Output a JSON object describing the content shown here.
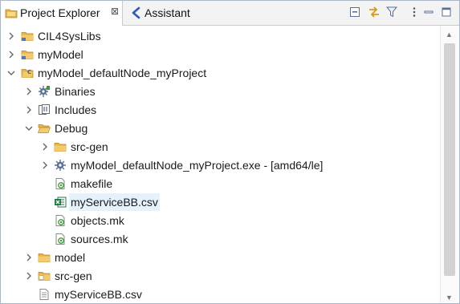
{
  "tabs": {
    "project_explorer": {
      "label": "Project Explorer",
      "close_glyph": "⊠"
    },
    "assistant": {
      "label": "Assistant"
    }
  },
  "toolbar": {
    "icons": [
      "collapse-all-icon",
      "link-with-editor-icon",
      "filter-icon",
      "view-menu-icon",
      "minimize-icon",
      "maximize-icon"
    ]
  },
  "tree": [
    {
      "label": "CIL4SysLibs",
      "icon": "project-folder-icon",
      "expanded": false,
      "depth": 0
    },
    {
      "label": "myModel",
      "icon": "project-folder-icon",
      "expanded": false,
      "depth": 0
    },
    {
      "label": "myModel_defaultNode_myProject",
      "icon": "cpp-project-folder-icon",
      "expanded": true,
      "depth": 0
    },
    {
      "label": "Binaries",
      "icon": "binaries-icon",
      "expanded": false,
      "depth": 1
    },
    {
      "label": "Includes",
      "icon": "includes-icon",
      "expanded": false,
      "depth": 1
    },
    {
      "label": "Debug",
      "icon": "folder-open-icon",
      "expanded": true,
      "depth": 1
    },
    {
      "label": "src-gen",
      "icon": "folder-icon",
      "expanded": false,
      "depth": 2
    },
    {
      "label": "myModel_defaultNode_myProject.exe - [amd64/le]",
      "icon": "executable-icon",
      "expanded": false,
      "depth": 2
    },
    {
      "label": "makefile",
      "icon": "makefile-icon",
      "expanded": null,
      "depth": 2
    },
    {
      "label": "myServiceBB.csv",
      "icon": "excel-csv-icon",
      "expanded": null,
      "depth": 2,
      "selected": true
    },
    {
      "label": "objects.mk",
      "icon": "makefile-icon",
      "expanded": null,
      "depth": 2
    },
    {
      "label": "sources.mk",
      "icon": "makefile-icon",
      "expanded": null,
      "depth": 2
    },
    {
      "label": "model",
      "icon": "folder-icon",
      "expanded": false,
      "depth": 1
    },
    {
      "label": "src-gen",
      "icon": "source-folder-icon",
      "expanded": false,
      "depth": 1
    },
    {
      "label": "myServiceBB.csv",
      "icon": "text-file-icon",
      "expanded": null,
      "depth": 1
    }
  ],
  "colors": {
    "selection": "#e5f1fb",
    "folder": "#e8b54a",
    "tab_border": "#a9b7c6",
    "excel_green": "#1d7a45"
  }
}
